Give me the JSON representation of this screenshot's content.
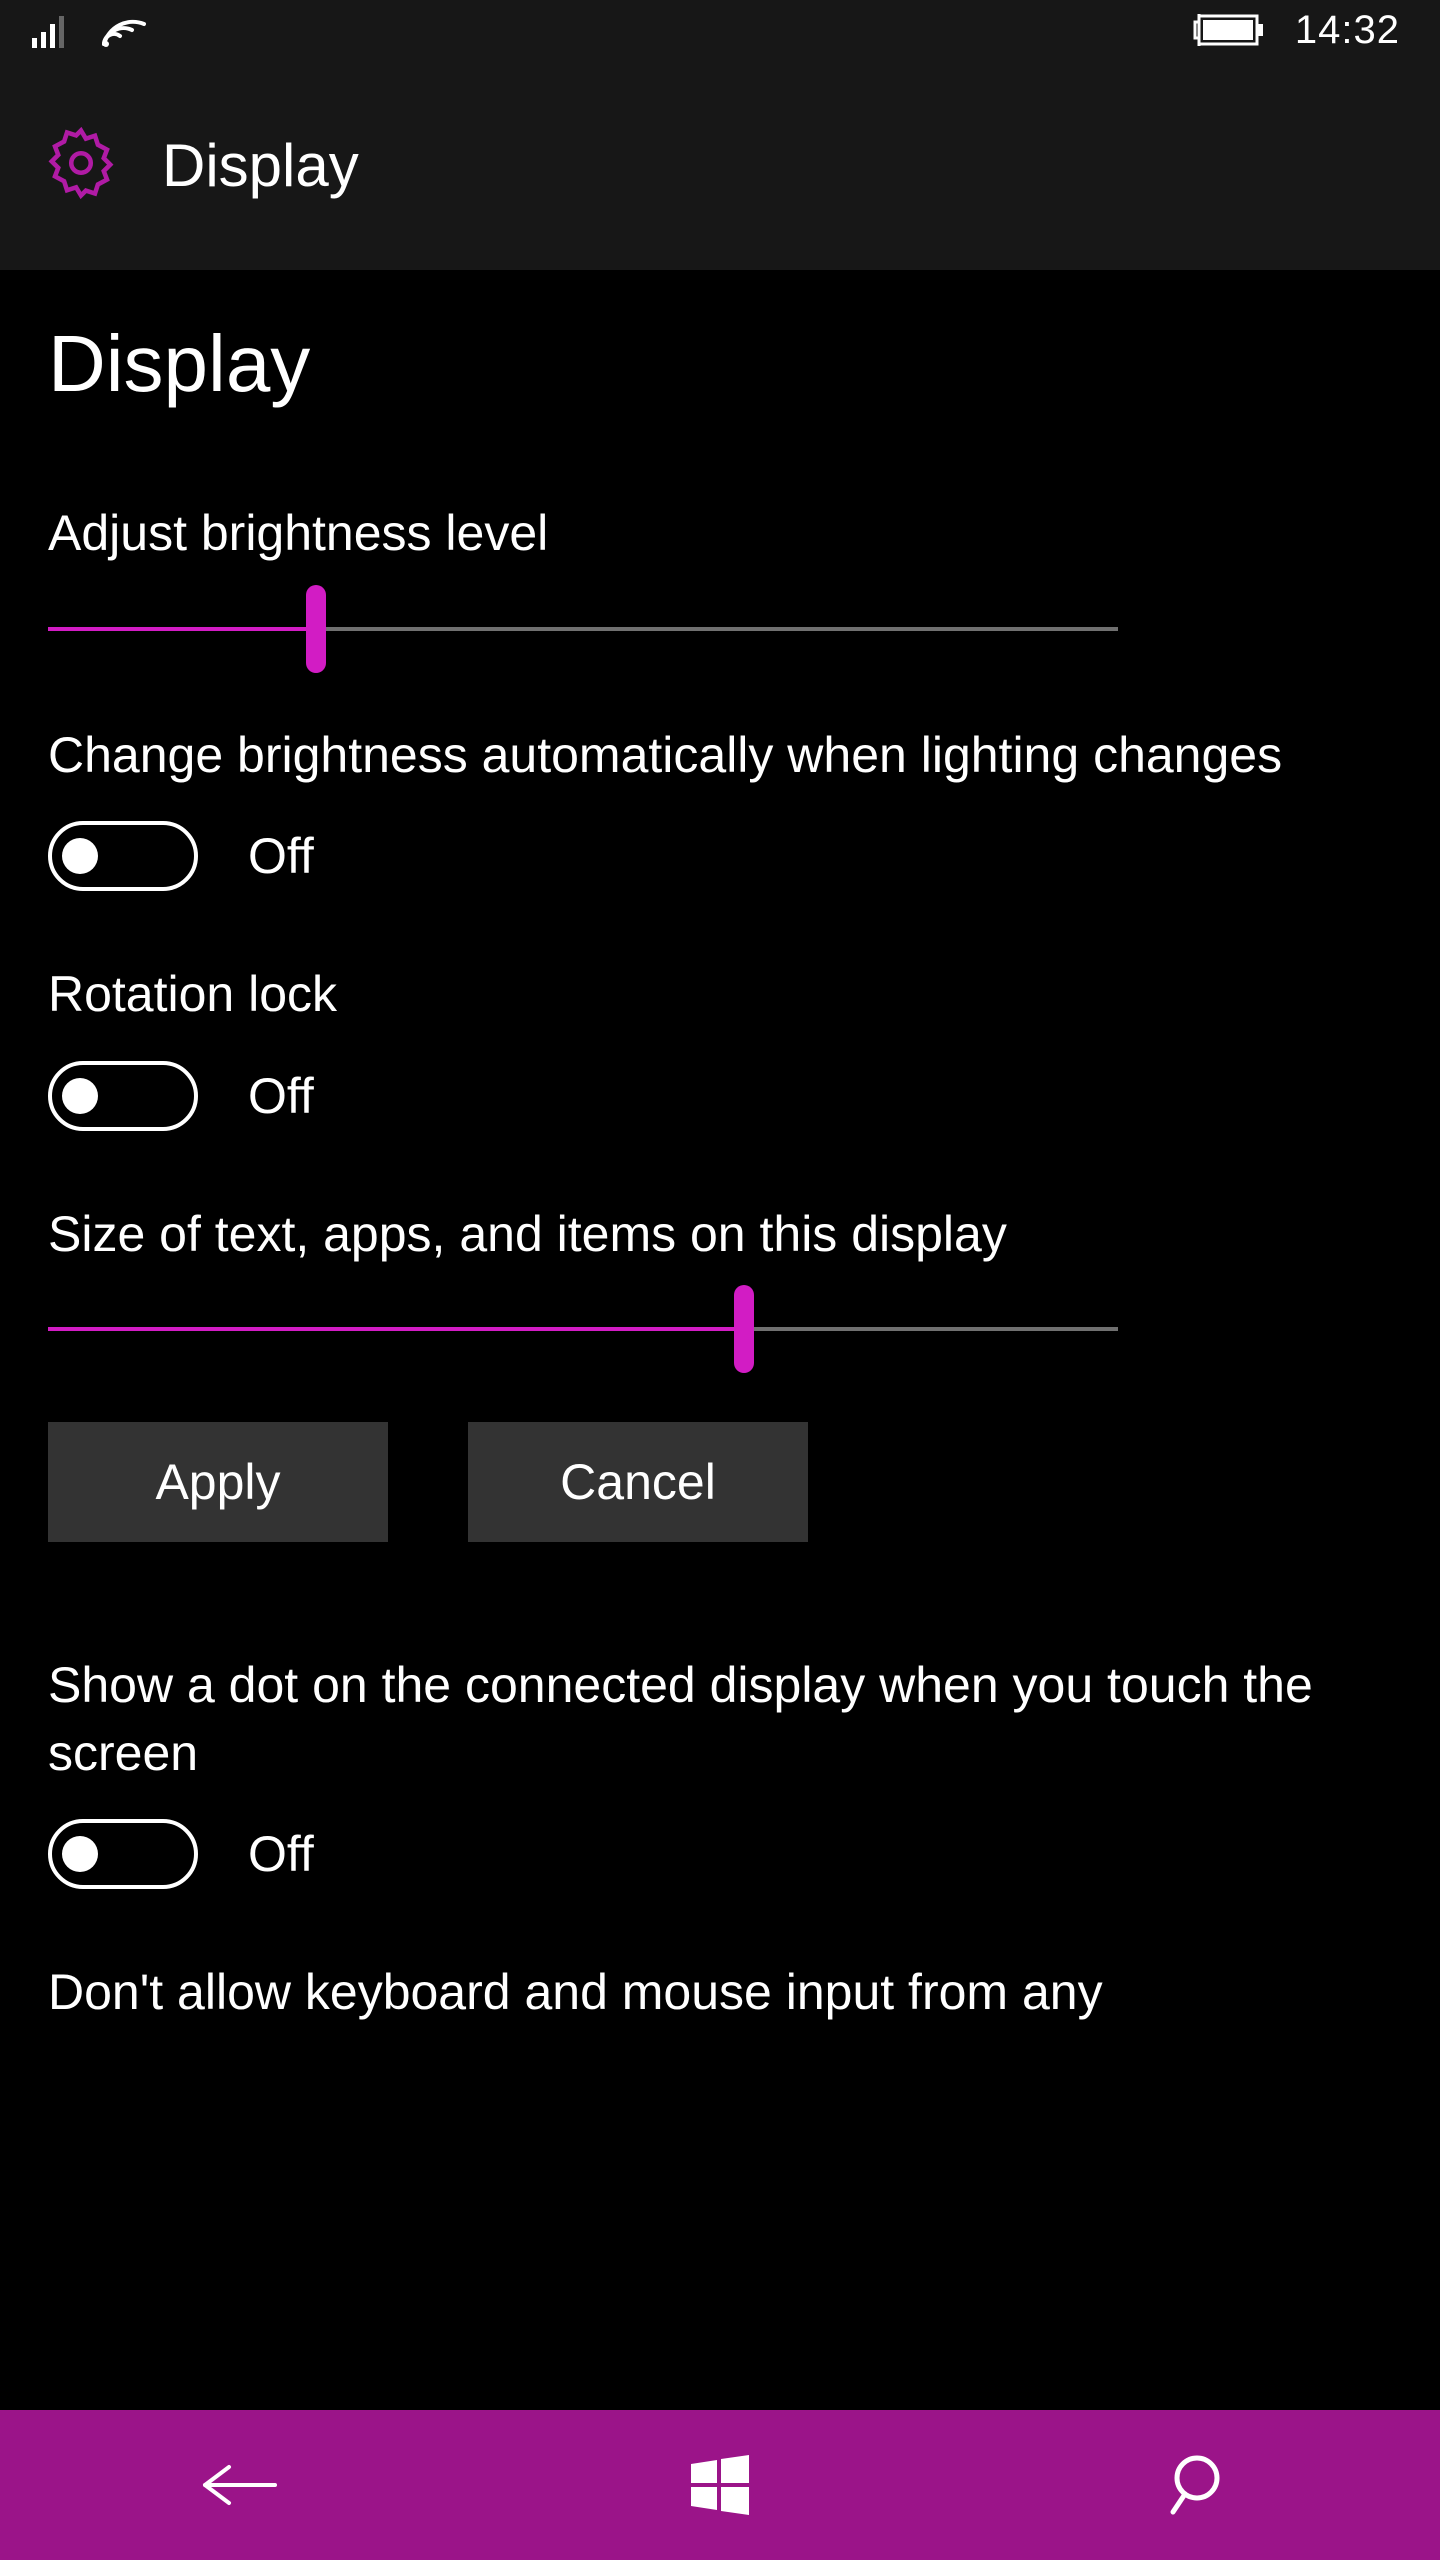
{
  "status": {
    "time": "14:32"
  },
  "titlebar": {
    "title": "Display"
  },
  "page": {
    "heading": "Display"
  },
  "brightness": {
    "label": "Adjust brightness level",
    "percent": 25
  },
  "auto_brightness": {
    "label": "Change brightness automatically when lighting changes",
    "state_text": "Off",
    "on": false
  },
  "rotation_lock": {
    "label": "Rotation lock",
    "state_text": "Off",
    "on": false
  },
  "scaling": {
    "label": "Size of text, apps, and items on this display",
    "percent": 65
  },
  "buttons": {
    "apply": "Apply",
    "cancel": "Cancel"
  },
  "touch_dot": {
    "label": "Show a dot on the connected display when you touch the screen",
    "state_text": "Off",
    "on": false
  },
  "cutoff_next": {
    "partial_text": "Don't allow keyboard and mouse input from any"
  },
  "colors": {
    "accent": "#d21cc4",
    "navbar": "#9b1489",
    "titlebar_bg": "#171717",
    "button_bg": "#333333"
  }
}
